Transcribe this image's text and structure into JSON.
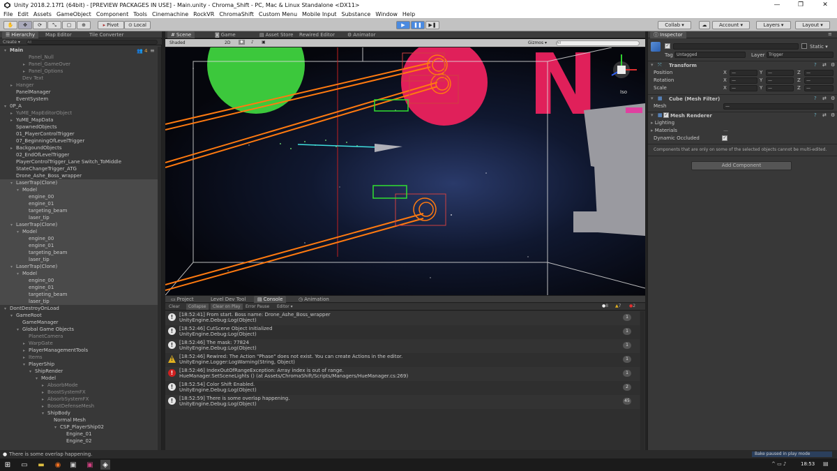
{
  "window": {
    "title": "Unity 2018.2.17f1 (64bit) - [PREVIEW PACKAGES IN USE] - Main.unity - Chroma_Shift - PC, Mac & Linux Standalone <DX11>",
    "min": "—",
    "max": "❐",
    "close": "✕"
  },
  "menu": [
    "File",
    "Edit",
    "Assets",
    "GameObject",
    "Component",
    "Tools",
    "Cinemachine",
    "RockVR",
    "ChromaShift",
    "Custom Menu",
    "Mobile Input",
    "Substance",
    "Window",
    "Help"
  ],
  "toolbar": {
    "pivot": "Pivot",
    "local": "Local",
    "collab": "Collab ▾",
    "account": "Account ▾",
    "layers": "Layers ▾",
    "layout": "Layout ▾"
  },
  "hierarchy": {
    "tabs": [
      "Hierarchy",
      "Map Editor",
      "Tile Converter"
    ],
    "create": "Create ▾",
    "search_placeholder": "All",
    "badge": "4",
    "rows": [
      {
        "t": "Main",
        "d": 0,
        "ar": "▾",
        "bold": true
      },
      {
        "t": "Panel_Null",
        "d": 3,
        "dim": true
      },
      {
        "t": "Panel_GameOver",
        "d": 3,
        "ar": "▸",
        "dim": true
      },
      {
        "t": "Panel_Options",
        "d": 3,
        "ar": "▸",
        "dim": true
      },
      {
        "t": "Dev Text",
        "d": 2,
        "dim": true
      },
      {
        "t": "Hanger",
        "d": 1,
        "ar": "▸",
        "dim": true
      },
      {
        "t": "PanelManager",
        "d": 1
      },
      {
        "t": "EventSystem",
        "d": 1
      },
      {
        "t": "0P_A",
        "d": 0,
        "ar": "▾"
      },
      {
        "t": "YuME_MapEditorObject",
        "d": 1,
        "ar": "▸",
        "dim": true
      },
      {
        "t": "YuME_MapData",
        "d": 1,
        "ar": "▸"
      },
      {
        "t": "SpawnedObjects",
        "d": 1
      },
      {
        "t": "01_PlayerControlTrigger",
        "d": 1
      },
      {
        "t": "07_BeginningOfLevelTrigger",
        "d": 1
      },
      {
        "t": "BackgoundObjects",
        "d": 1,
        "ar": "▸"
      },
      {
        "t": "02_EndOfLevelTrigger",
        "d": 1
      },
      {
        "t": "PlayerControlTrigger_Lane Switch_ToMiddle",
        "d": 1
      },
      {
        "t": "StateChangeTrigger_ATG",
        "d": 1
      },
      {
        "t": "Drone_Ashe_Boss_wrapper",
        "d": 1
      },
      {
        "t": "LaserTrap(Clone)",
        "d": 1,
        "ar": "▾",
        "sel": true
      },
      {
        "t": "Model",
        "d": 2,
        "ar": "▾",
        "sel": true
      },
      {
        "t": "engine_00",
        "d": 3,
        "sel": true
      },
      {
        "t": "engine_01",
        "d": 3,
        "sel": true
      },
      {
        "t": "targeting_beam",
        "d": 3,
        "sel": true
      },
      {
        "t": "laser_tip",
        "d": 3,
        "sel": true
      },
      {
        "t": "LaserTrap(Clone)",
        "d": 1,
        "ar": "▾",
        "sel": true
      },
      {
        "t": "Model",
        "d": 2,
        "ar": "▾",
        "sel": true
      },
      {
        "t": "engine_00",
        "d": 3,
        "sel": true
      },
      {
        "t": "engine_01",
        "d": 3,
        "sel": true
      },
      {
        "t": "targeting_beam",
        "d": 3,
        "sel": true
      },
      {
        "t": "laser_tip",
        "d": 3,
        "sel": true
      },
      {
        "t": "LaserTrap(Clone)",
        "d": 1,
        "ar": "▾",
        "sel": true
      },
      {
        "t": "Model",
        "d": 2,
        "ar": "▾",
        "sel": true
      },
      {
        "t": "engine_00",
        "d": 3,
        "sel": true
      },
      {
        "t": "engine_01",
        "d": 3,
        "sel": true
      },
      {
        "t": "targeting_beam",
        "d": 3,
        "sel": true
      },
      {
        "t": "laser_tip",
        "d": 3,
        "sel": true
      },
      {
        "t": "DontDestroyOnLoad",
        "d": 0,
        "ar": "▾"
      },
      {
        "t": "GameRoot",
        "d": 1,
        "ar": "▾"
      },
      {
        "t": "GameManager",
        "d": 2
      },
      {
        "t": "Global Game Objects",
        "d": 2,
        "ar": "▾"
      },
      {
        "t": "PlanetCamera",
        "d": 3,
        "dim": true
      },
      {
        "t": "WarpGate",
        "d": 3,
        "ar": "▸",
        "dim": true
      },
      {
        "t": "PlayerManagementTools",
        "d": 3,
        "ar": "▸"
      },
      {
        "t": "Items",
        "d": 3,
        "ar": "▸",
        "dim": true
      },
      {
        "t": "PlayerShip",
        "d": 3,
        "ar": "▾"
      },
      {
        "t": "ShipRender",
        "d": 4,
        "ar": "▾"
      },
      {
        "t": "Model",
        "d": 5,
        "ar": "▾"
      },
      {
        "t": "AbsorbMode",
        "d": 6,
        "ar": "▸",
        "dim": true
      },
      {
        "t": "BoostSystemFX",
        "d": 6,
        "ar": "▸",
        "dim": true
      },
      {
        "t": "AbsorbSystemFX",
        "d": 6,
        "ar": "▸",
        "dim": true
      },
      {
        "t": "BoostDefenseMesh",
        "d": 6,
        "ar": "▸",
        "dim": true
      },
      {
        "t": "ShipBody",
        "d": 6,
        "ar": "▾"
      },
      {
        "t": "Normal Mesh",
        "d": 7
      },
      {
        "t": "CSP_PlayerShip02",
        "d": 8,
        "ar": "▾"
      },
      {
        "t": "Engine_01",
        "d": 9
      },
      {
        "t": "Engine_02",
        "d": 9
      }
    ]
  },
  "scene": {
    "tabs": [
      "Scene",
      "Game",
      "Asset Store",
      "Rewired Editor",
      "Animator"
    ],
    "shading": "Shaded",
    "mode2d": "2D",
    "gizmos": "Gizmos ▾",
    "search_placeholder": "All",
    "iso": "Iso"
  },
  "console": {
    "tabs": [
      "Project",
      "Level Dev Tool",
      "Console",
      "Animation"
    ],
    "buttons": [
      "Clear",
      "Collapse",
      "Clear on Play",
      "Error Pause",
      "Editor ▾"
    ],
    "counts": {
      "info": "8",
      "warn": "7",
      "error": "2"
    },
    "entries": [
      {
        "kind": "info",
        "l1": "[18:52:41] From start. Boss name: Drone_Ashe_Boss_wrapper",
        "l2": "UnityEngine.Debug:Log(Object)",
        "n": "1"
      },
      {
        "kind": "info",
        "l1": "[18:52:46] CutScene Object Initialized",
        "l2": "UnityEngine.Debug:Log(Object)",
        "n": "1"
      },
      {
        "kind": "info",
        "l1": "[18:52:46] The mask: 77824",
        "l2": "UnityEngine.Debug:Log(Object)",
        "n": "1"
      },
      {
        "kind": "warn",
        "l1": "[18:52:46] Rewired: The Action \"Phase\" does not exist. You can create Actions in the editor.",
        "l2": "UnityEngine.Logger:LogWarning(String, Object)",
        "n": "1"
      },
      {
        "kind": "error",
        "l1": "[18:52:46] IndexOutOfRangeException: Array index is out of range.",
        "l2": "HueManager.SetSceneLights () (at Assets/ChromaShift/Scripts/Managers/HueManager.cs:269)",
        "n": "1"
      },
      {
        "kind": "info",
        "l1": "[18:52:54] Color Shift Enabled.",
        "l2": "UnityEngine.Debug:Log(Object)",
        "n": "2"
      },
      {
        "kind": "info",
        "l1": "[18:52:59] There is some overlap happening.",
        "l2": "UnityEngine.Debug:Log(Object)",
        "n": "45"
      }
    ]
  },
  "inspector": {
    "tab": "Inspector",
    "static": "Static ▾",
    "tag_label": "Tag",
    "tag": "Untagged",
    "layer_label": "Layer",
    "layer": "Trigger",
    "transform": "Transform",
    "position": "Position",
    "rotation": "Rotation",
    "scale": "Scale",
    "x": "X",
    "y": "Y",
    "z": "Z",
    "dash": "—",
    "meshfilter": "Cube (Mesh Filter)",
    "mesh_label": "Mesh",
    "meshrenderer": "Mesh Renderer",
    "lighting": "Lighting",
    "materials": "Materials",
    "dynamic_occluded": "Dynamic Occluded",
    "note": "Components that are only on some of the selected objects cannot be multi-edited.",
    "add_component": "Add Component"
  },
  "status": {
    "message": "There is some overlap happening.",
    "bake": "Bake paused in play mode"
  },
  "taskbar": {
    "time": "18:53"
  }
}
